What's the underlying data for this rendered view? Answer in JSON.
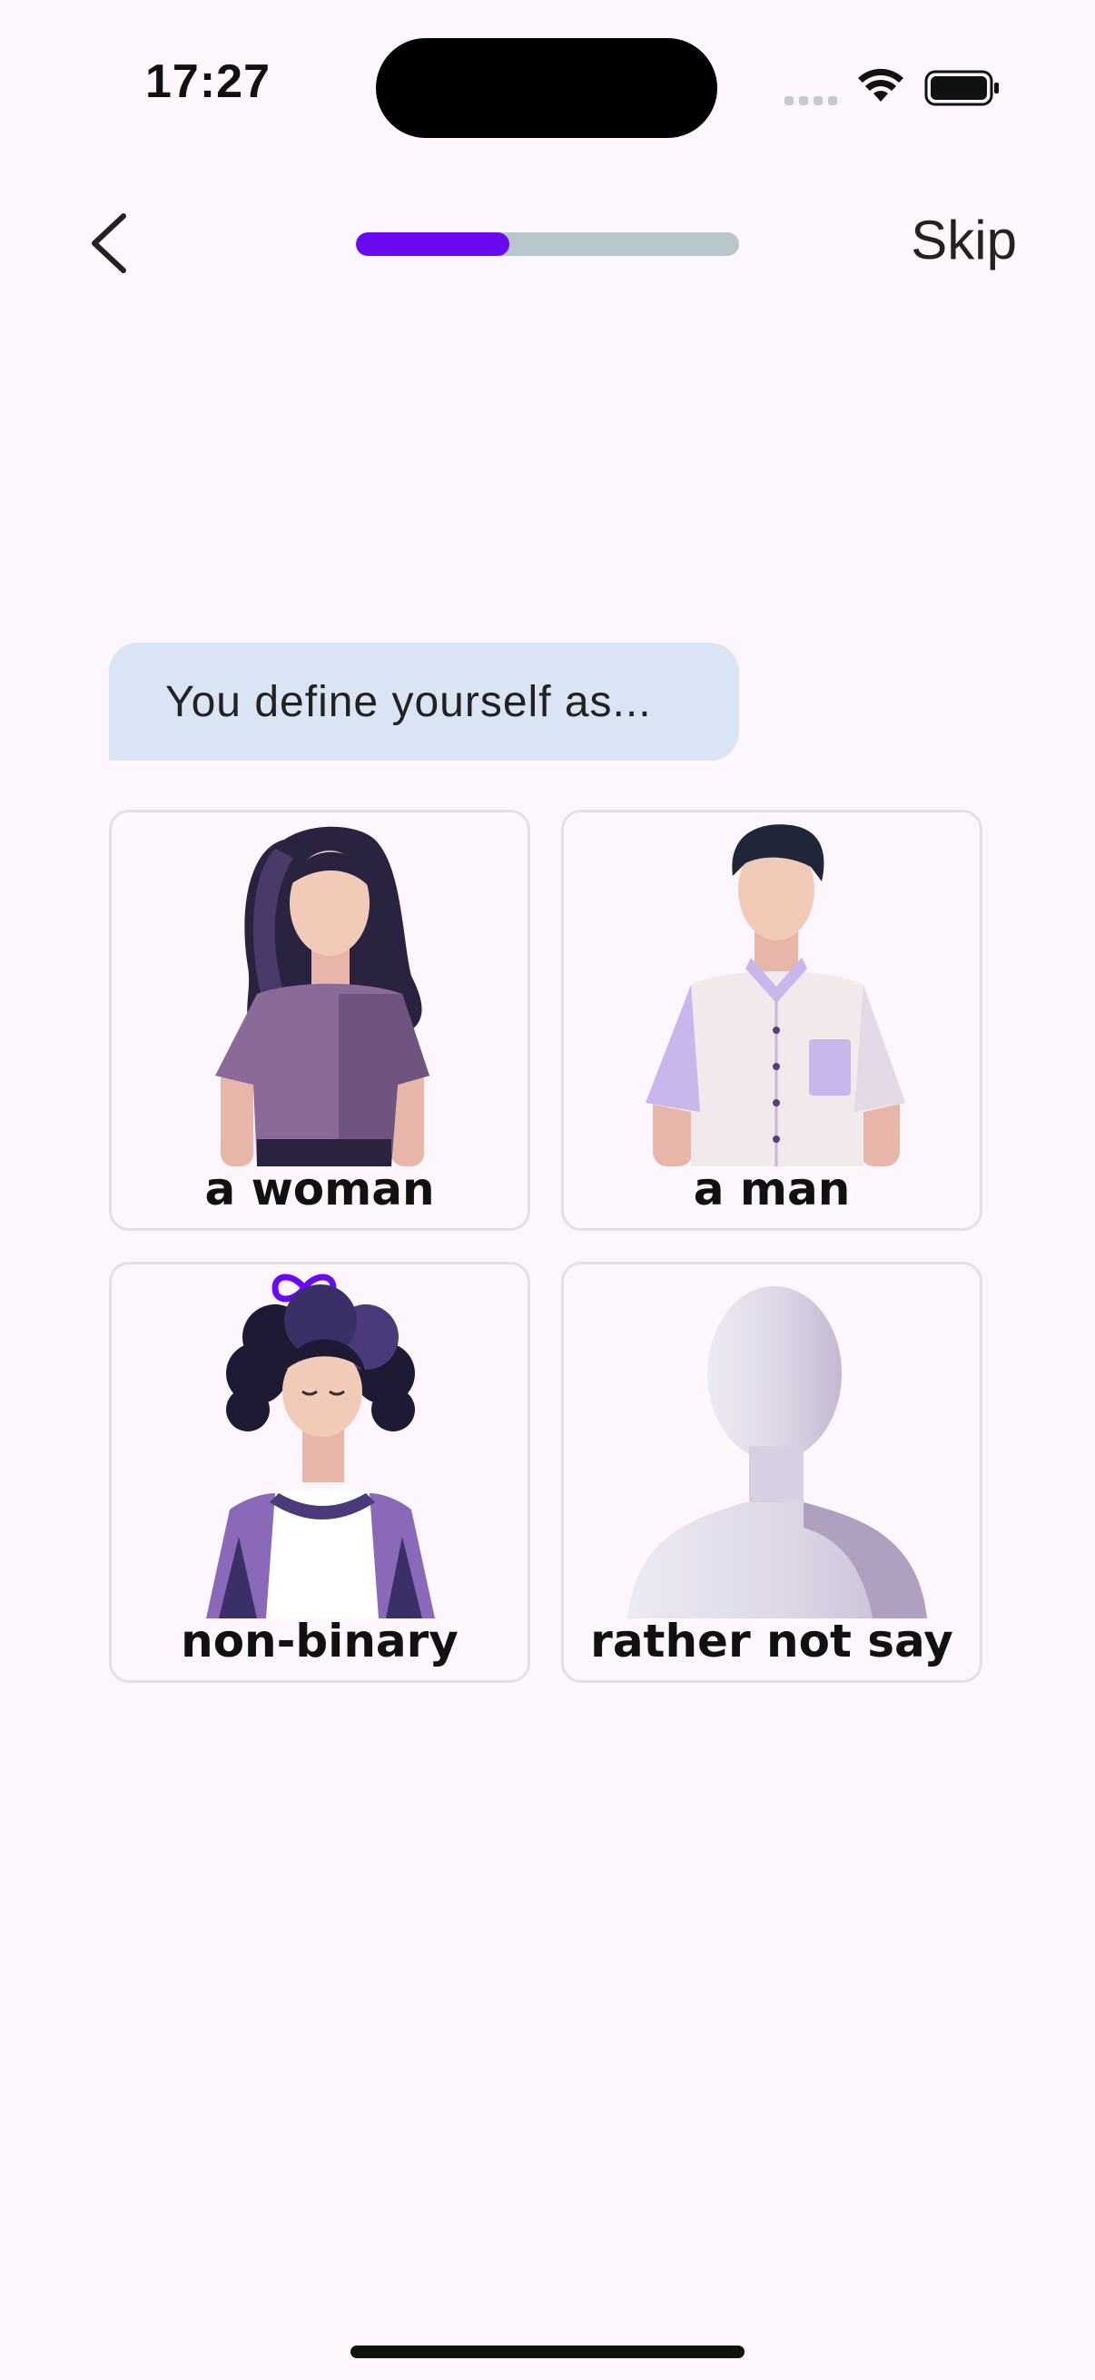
{
  "status_bar": {
    "time": "17:27"
  },
  "nav": {
    "back_icon": "chevron-left-icon",
    "skip_label": "Skip",
    "progress": 0.4,
    "progress_color": "#6a0af0",
    "progress_track_color": "#b8c7cc"
  },
  "prompt": {
    "text": "You define yourself as..."
  },
  "options": [
    {
      "label": "a woman",
      "illustration": "woman-avatar"
    },
    {
      "label": "a man",
      "illustration": "man-avatar"
    },
    {
      "label": "non-binary",
      "illustration": "non-binary-avatar"
    },
    {
      "label": "rather not say",
      "illustration": "anonymous-avatar"
    }
  ],
  "colors": {
    "background": "#fdf6fd",
    "bubble": "#d9e5f5",
    "accent": "#6a0af0"
  }
}
